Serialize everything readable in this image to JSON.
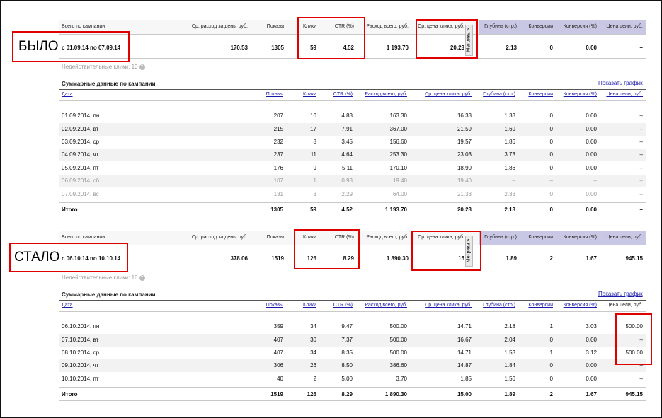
{
  "top_headers": {
    "total": "Всего по кампании",
    "avg_day": "Ср. расход за день, руб.",
    "shows": "Показы",
    "clicks": "Клики",
    "ctr": "CTR (%)",
    "spend": "Расход всего, руб.",
    "cpc": "Ср. цена клика, руб.",
    "depth": "Глубина (стр.)",
    "conv": "Конверсии",
    "conv_pct": "Конверсия (%)",
    "goal": "Цена цели, руб."
  },
  "table_headers": {
    "date": "Дата",
    "shows": "Показы",
    "clicks": "Клики",
    "ctr": "CTR (%)",
    "spend": "Расход всего, руб.",
    "cpc": "Ср. цена клика, руб.",
    "depth": "Глубина (стр.)",
    "conv": "Конверсии",
    "conv_pct": "Конверсия (%)",
    "goal": "Цена цели, руб."
  },
  "metrika": "Метрика »",
  "section_title": "Суммарные данные по кампании",
  "show_chart": "Показать график",
  "before": {
    "label": "БЫЛО",
    "period": "с 01.09.14 по 07.09.14",
    "avg_day": "170.53",
    "shows": "1305",
    "clicks": "59",
    "ctr": "4.52",
    "spend": "1 193.70",
    "cpc": "20.23",
    "depth": "2.13",
    "conv": "0",
    "conv_pct": "0.00",
    "goal": "–",
    "invalid": "Недействительные клики: 10",
    "rows": [
      [
        "01.09.2014, пн",
        "207",
        "10",
        "4.83",
        "163.30",
        "16.33",
        "1.33",
        "0",
        "0.00",
        "–"
      ],
      [
        "02.09.2014, вт",
        "215",
        "17",
        "7.91",
        "367.00",
        "21.59",
        "1.69",
        "0",
        "0.00",
        "–"
      ],
      [
        "03.09.2014, ср",
        "232",
        "8",
        "3.45",
        "156.60",
        "19.57",
        "1.86",
        "0",
        "0.00",
        "–"
      ],
      [
        "04.09.2014, чт",
        "237",
        "11",
        "4.64",
        "253.30",
        "23.03",
        "3.73",
        "0",
        "0.00",
        "–"
      ],
      [
        "05.09.2014, пт",
        "176",
        "9",
        "5.11",
        "170.10",
        "18.90",
        "1.86",
        "0",
        "0.00",
        "–"
      ],
      [
        "06.09.2014, сб",
        "107",
        "1",
        "0.93",
        "19.40",
        "19.40",
        "–",
        "–",
        "–",
        "–"
      ],
      [
        "07.09.2014, вс",
        "131",
        "3",
        "2.29",
        "64.00",
        "21.33",
        "2.33",
        "0",
        "0.00",
        "–"
      ]
    ],
    "total": [
      "Итого",
      "1305",
      "59",
      "4.52",
      "1 193.70",
      "20.23",
      "2.13",
      "0",
      "0.00",
      "–"
    ]
  },
  "after": {
    "label": "СТАЛО",
    "period": "с 06.10.14 по 10.10.14",
    "avg_day": "378.06",
    "shows": "1519",
    "clicks": "126",
    "ctr": "8.29",
    "spend": "1 890.30",
    "cpc": "15",
    "depth": "1.89",
    "conv": "2",
    "conv_pct": "1.67",
    "goal": "945.15",
    "invalid": "Недействительные клики: 16",
    "rows": [
      [
        "06.10.2014, пн",
        "359",
        "34",
        "9.47",
        "500.00",
        "14.71",
        "2.18",
        "1",
        "3.03",
        "500.00"
      ],
      [
        "07.10.2014, вт",
        "407",
        "30",
        "7.37",
        "500.00",
        "16.67",
        "2.04",
        "0",
        "0.00",
        "–"
      ],
      [
        "08.10.2014, ср",
        "407",
        "34",
        "8.35",
        "500.00",
        "14.71",
        "1.53",
        "1",
        "3.12",
        "500.00"
      ],
      [
        "09.10.2014, чт",
        "306",
        "26",
        "8.50",
        "386.60",
        "14.87",
        "1.84",
        "0",
        "0.00",
        "–"
      ],
      [
        "10.10.2014, пт",
        "40",
        "2",
        "5.00",
        "3.70",
        "1.85",
        "1.50",
        "0",
        "0.00",
        "–"
      ]
    ],
    "total": [
      "Итого",
      "1519",
      "126",
      "8.29",
      "1 890.30",
      "15.00",
      "1.89",
      "2",
      "1.67",
      "945.15"
    ]
  },
  "colors": {
    "highlight": "#e00000",
    "lilac": "#c9c8e4",
    "link": "#1a1aaa"
  }
}
